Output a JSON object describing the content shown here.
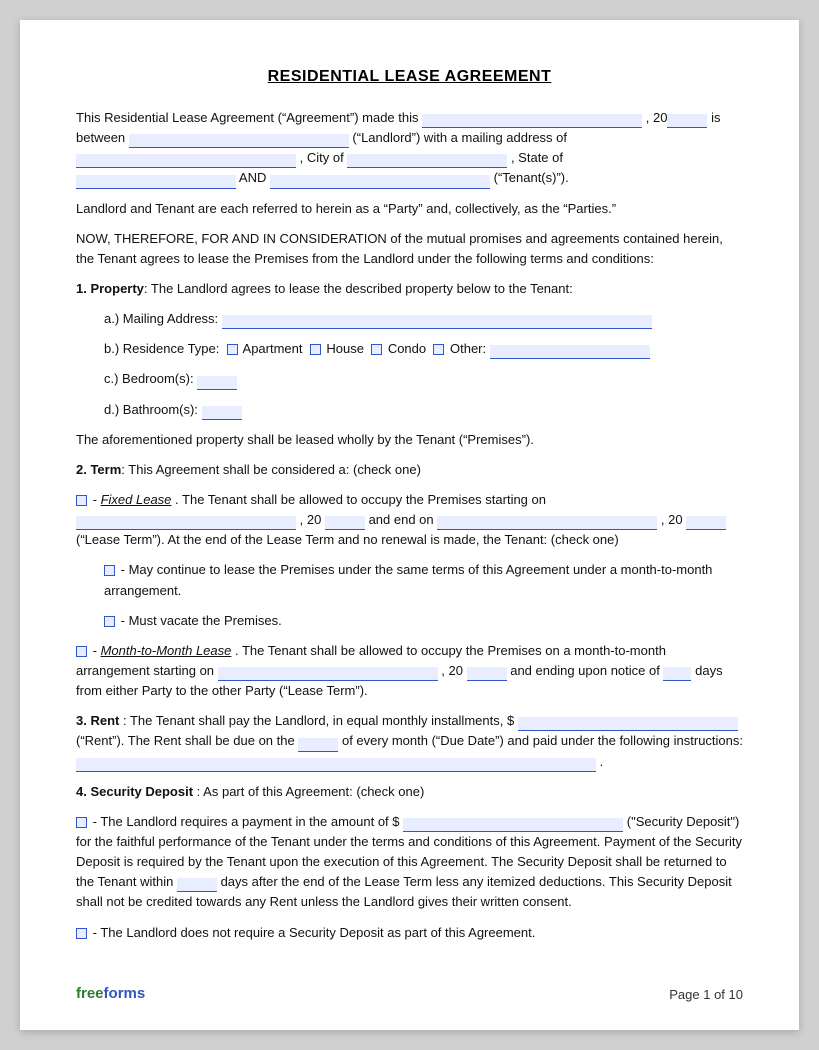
{
  "title": "RESIDENTIAL LEASE AGREEMENT",
  "intro": {
    "line1a": "This Residential Lease Agreement (“Agreement”) made this",
    "line1b": ", 20",
    "line1c": " is",
    "line2a": "between",
    "line2b": "(“Landlord”) with a mailing address of",
    "line3a": ", City of",
    "line3b": ", State of",
    "line4a": "AND",
    "line4b": "(“Tenant(s)”)."
  },
  "parties_text": "Landlord and Tenant are each referred to herein as a “Party” and, collectively, as the “Parties.”",
  "now_therefore": "NOW, THEREFORE, FOR AND IN CONSIDERATION of the mutual promises and agreements contained herein, the Tenant agrees to lease the Premises from the Landlord under the following terms and conditions:",
  "section1": {
    "label": "1. Property",
    "text": ": The Landlord agrees to lease the described property below to the Tenant:",
    "a_label": "a.)  Mailing Address:",
    "b_label": "b.)  Residence Type:",
    "b_options": [
      "Apartment",
      "House",
      "Condo",
      "Other:"
    ],
    "c_label": "c.)  Bedroom(s):",
    "d_label": "d.)  Bathroom(s):",
    "premises_text": "The aforementioned property shall be leased wholly by the Tenant (“Premises”)."
  },
  "section2": {
    "label": "2. Term",
    "text": ": This Agreement shall be considered a: (check one)",
    "fixed_label": "Fixed Lease",
    "fixed_text1": ". The Tenant shall be allowed to occupy the Premises starting on",
    "fixed_text2": ", 20",
    "fixed_text3": " and end on",
    "fixed_text4": ", 20",
    "fixed_text5": " (“Lease Term”). At the end of the Lease Term and no renewal is made, the Tenant: (check one)",
    "option1": "- May continue to lease the Premises under the same terms of this Agreement under a month-to-month arrangement.",
    "option2": "- Must vacate the Premises.",
    "month_label": "Month-to-Month Lease",
    "month_text1": ". The Tenant shall be allowed to occupy the Premises on a month-to-month arrangement starting on",
    "month_text2": ", 20",
    "month_text3": " and ending upon notice of",
    "month_text4": " days from either Party to the other Party (“Lease Term”)."
  },
  "section3": {
    "label": "3. Rent",
    "text1": ": The Tenant shall pay the Landlord, in equal monthly installments, $",
    "text2": "(“Rent”). The Rent shall be due on the",
    "text3": " of every month (“Due Date”) and paid under the following instructions:",
    "text4": "."
  },
  "section4": {
    "label": "4. Security Deposit",
    "text": ": As part of this Agreement: (check one)",
    "option1_text1": "- The Landlord requires a payment in the amount of $",
    "option1_text2": " (“Security Deposit”) for the faithful performance of the Tenant under the terms and conditions of this Agreement. Payment of the Security Deposit is required by the Tenant upon the execution of this Agreement. The Security Deposit shall be returned to the Tenant within",
    "option1_text3": " days after the end of the Lease Term less any itemized deductions. This Security Deposit shall not be credited towards any Rent unless the Landlord gives their written consent.",
    "option2_text": "- The Landlord does not require a Security Deposit as part of this Agreement."
  },
  "footer": {
    "logo_free": "free",
    "logo_forms": "forms",
    "page_label": "Page 1 of 10"
  }
}
